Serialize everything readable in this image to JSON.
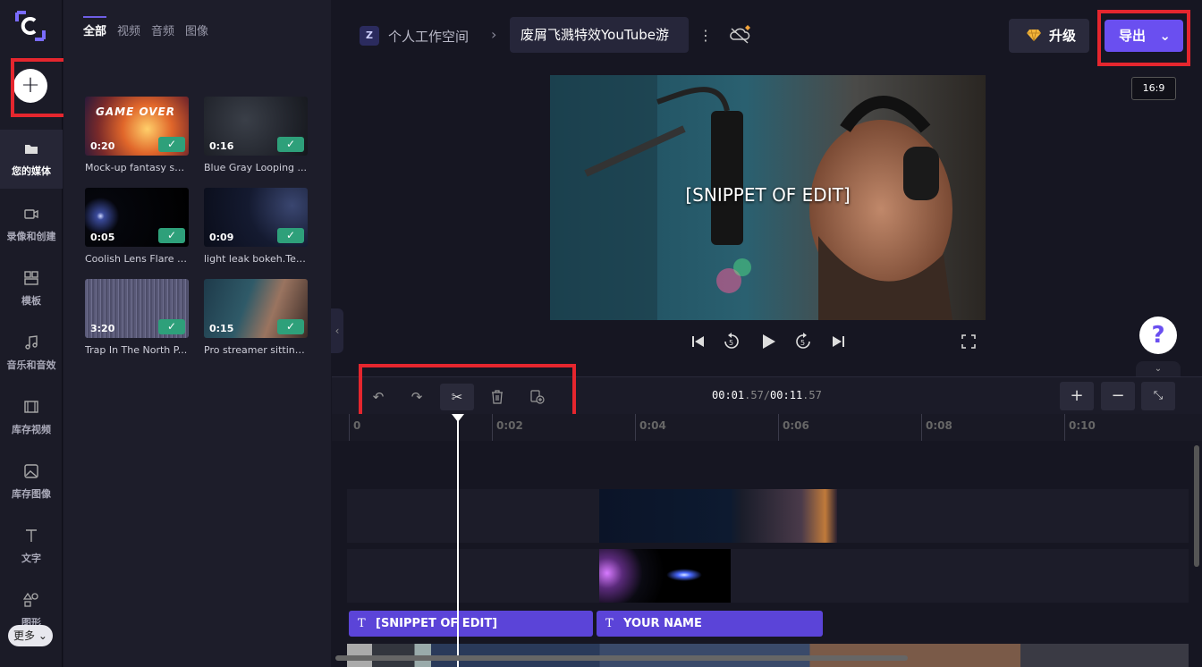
{
  "rail": {
    "items": [
      {
        "label": "您的媒体",
        "icon": "folder-icon"
      },
      {
        "label": "录像和创建",
        "icon": "camera-icon"
      },
      {
        "label": "模板",
        "icon": "template-icon"
      },
      {
        "label": "音乐和音效",
        "icon": "music-icon"
      },
      {
        "label": "库存视频",
        "icon": "film-icon"
      },
      {
        "label": "库存图像",
        "icon": "image-icon"
      },
      {
        "label": "文字",
        "icon": "text-icon"
      },
      {
        "label": "图形",
        "icon": "shapes-icon"
      }
    ],
    "more_label": "更多"
  },
  "media": {
    "tabs": [
      "全部",
      "视频",
      "音频",
      "图像"
    ],
    "cards": [
      {
        "duration": "0:20",
        "caption": "Mock-up fantasy sp...",
        "badge_text": "GAME OVER"
      },
      {
        "duration": "0:16",
        "caption": "Blue Gray Looping ..."
      },
      {
        "duration": "0:05",
        "caption": "Coolish Lens Flare 1..."
      },
      {
        "duration": "0:09",
        "caption": "light leak bokeh.Tes..."
      },
      {
        "duration": "3:20",
        "caption": "Trap In The North P..."
      },
      {
        "duration": "0:15",
        "caption": "Pro streamer sitting..."
      }
    ]
  },
  "header": {
    "workspace_initial": "Z",
    "workspace_name": "个人工作空间",
    "project_title": "废屑飞溅特效YouTube游",
    "upgrade_label": "升级",
    "export_label": "导出",
    "aspect_ratio": "16:9"
  },
  "preview": {
    "overlay_text": "[SNIPPET OF EDIT]"
  },
  "help_label": "?",
  "timeline": {
    "current_time": "00:01",
    "current_frac": ".57",
    "total_time": "00:11",
    "total_frac": ".57",
    "ruler": [
      "0",
      "0:02",
      "0:04",
      "0:06",
      "0:08",
      "0:10"
    ],
    "text_clips": [
      "[SNIPPET OF EDIT]",
      "YOUR NAME"
    ]
  },
  "colors": {
    "accent": "#6a4ff0",
    "highlight": "#e5262e",
    "check": "#2ea07a"
  }
}
